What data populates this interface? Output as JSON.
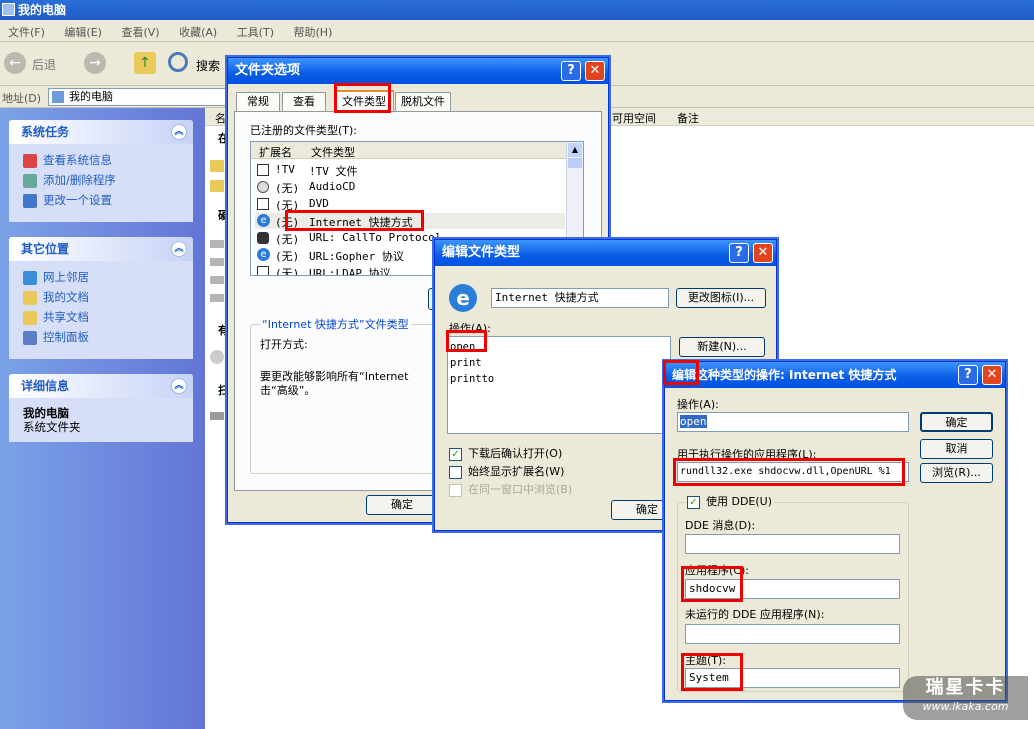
{
  "explorer": {
    "title": "我的电脑",
    "menu": [
      "文件(F)",
      "编辑(E)",
      "查看(V)",
      "收藏(A)",
      "工具(T)",
      "帮助(H)"
    ],
    "toolbar": {
      "back": "后退",
      "search": "搜索"
    },
    "address_label": "地址(D)",
    "address_value": "我的电脑",
    "columns": [
      "可用空间",
      "备注"
    ],
    "list_fragments": [
      "名",
      "在",
      "硬",
      "有",
      "扫"
    ],
    "panels": {
      "system_tasks": {
        "title": "系统任务",
        "items": [
          "查看系统信息",
          "添加/删除程序",
          "更改一个设置"
        ]
      },
      "other_places": {
        "title": "其它位置",
        "items": [
          "网上邻居",
          "我的文档",
          "共享文档",
          "控制面板"
        ]
      },
      "details": {
        "title": "详细信息",
        "name": "我的电脑",
        "desc": "系统文件夹"
      }
    }
  },
  "folder_options": {
    "title": "文件夹选项",
    "tabs": [
      "常规",
      "查看",
      "文件类型",
      "脱机文件"
    ],
    "registered_label": "已注册的文件类型(T):",
    "columns": [
      "扩展名",
      "文件类型"
    ],
    "rows": [
      {
        "ext": "!TV",
        "type": "!TV 文件"
      },
      {
        "ext": "(无)",
        "type": "AudioCD"
      },
      {
        "ext": "(无)",
        "type": "DVD"
      },
      {
        "ext": "(无)",
        "type": "Internet 快捷方式"
      },
      {
        "ext": "(无)",
        "type": "URL: CallTo Protocol"
      },
      {
        "ext": "(无)",
        "type": "URL:Gopher 协议"
      },
      {
        "ext": "(无)",
        "type": "URL:LDAP 协议"
      }
    ],
    "details_title": "“Internet 快捷方式”文件类型",
    "opens_with": "打开方式:",
    "desc_line1": "要更改能够影响所有“Internet",
    "desc_line2": "击“高级”。",
    "ok": "确定"
  },
  "edit_type": {
    "title": "编辑文件类型",
    "name_value": "Internet 快捷方式",
    "change_icon": "更改图标(I)...",
    "actions_label": "操作(A):",
    "actions": [
      "open",
      "print",
      "printto"
    ],
    "new_button": "新建(N)...",
    "check_confirm": "下载后确认打开(O)",
    "check_show_ext": "始终显示扩展名(W)",
    "check_same_window": "在同一窗口中浏览(B)",
    "ok": "确定"
  },
  "edit_action": {
    "title": "编辑这种类型的操作: Internet 快捷方式",
    "action_label": "操作(A):",
    "action_value": "open",
    "app_label": "用于执行操作的应用程序(L):",
    "app_value": "rundll32.exe shdocvw.dll,OpenURL %1",
    "ok": "确定",
    "cancel": "取消",
    "browse": "浏览(R)...",
    "use_dde": "使用 DDE(U)",
    "dde_message_label": "DDE 消息(D):",
    "application_label": "应用程序(C):",
    "application_value": "shdocvw",
    "dde_not_running_label": "未运行的 DDE 应用程序(N):",
    "topic_label": "主题(T):",
    "topic_value": "System"
  },
  "watermark": {
    "brand": "瑞星卡卡",
    "url": "www.ikaka.com"
  },
  "colors": {
    "xp_blue": "#0a5ce5",
    "highlight_red": "#e00000",
    "selection": "#316ac5"
  }
}
